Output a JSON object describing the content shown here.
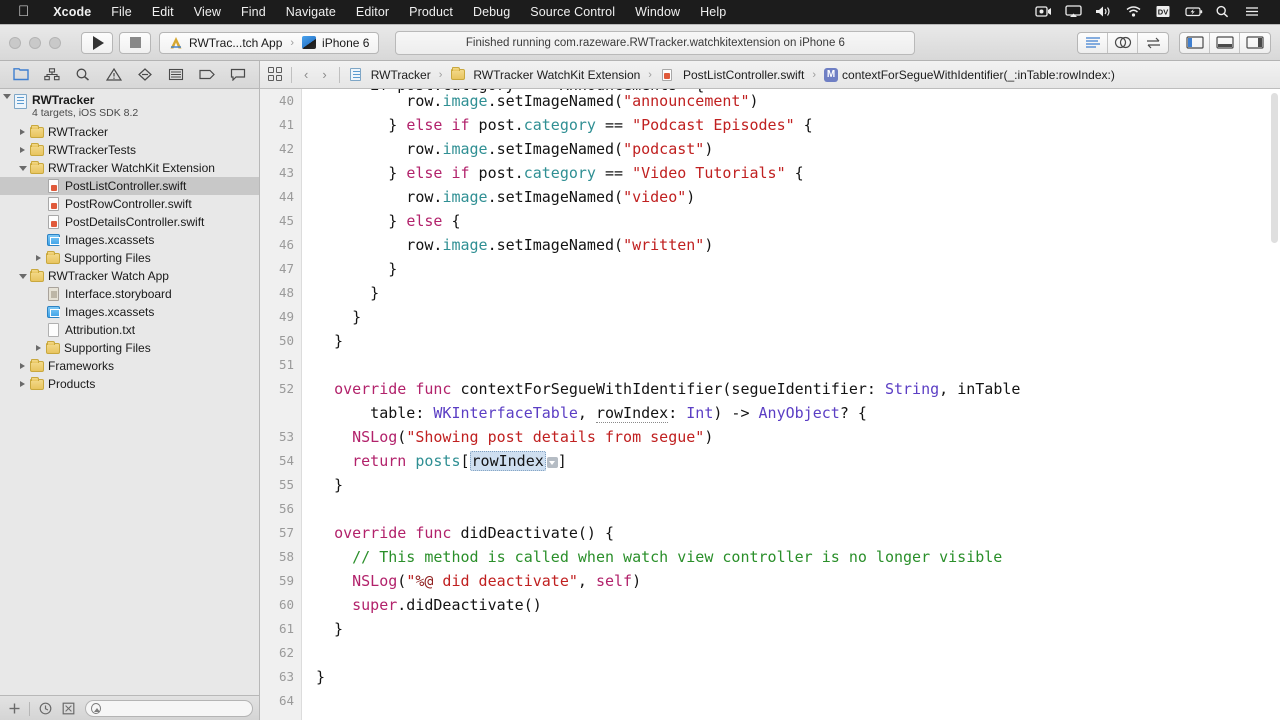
{
  "menubar": {
    "apple_icon": "apple-logo",
    "items": [
      "Xcode",
      "File",
      "Edit",
      "View",
      "Find",
      "Navigate",
      "Editor",
      "Product",
      "Debug",
      "Source Control",
      "Window",
      "Help"
    ],
    "status_icons": [
      "screen-record-icon",
      "airplay-icon",
      "volume-icon",
      "wifi-icon",
      "dv-icon",
      "battery-charging-icon",
      "spotlight-search-icon",
      "notification-center-icon"
    ],
    "dv_label": "DV"
  },
  "toolbar": {
    "run_button": "run-button",
    "stop_button": "stop-button",
    "scheme": {
      "target": "RWTrac...tch App",
      "separator": "›",
      "destination": "iPhone 6"
    },
    "activity_status": "Finished running com.razeware.RWTracker.watchkitextension on iPhone 6",
    "editor_segments": [
      "standard-editor",
      "assistant-editor",
      "version-editor"
    ],
    "view_segments": [
      "navigator-toggle",
      "debug-area-toggle",
      "utilities-toggle"
    ]
  },
  "navigator": {
    "tabs": [
      "project-navigator",
      "symbol-navigator",
      "find-navigator",
      "issue-navigator",
      "test-navigator",
      "debug-navigator",
      "breakpoint-navigator",
      "report-navigator"
    ],
    "active_tab": "project-navigator",
    "tree": [
      {
        "label": "RWTracker",
        "sub": "4 targets, iOS SDK 8.2",
        "icon": "project-icon",
        "indent": 0,
        "twisty": "open",
        "kind": "root"
      },
      {
        "label": "RWTracker",
        "icon": "folder-icon",
        "indent": 1,
        "twisty": "closed",
        "kind": "group"
      },
      {
        "label": "RWTrackerTests",
        "icon": "folder-icon",
        "indent": 1,
        "twisty": "closed",
        "kind": "group"
      },
      {
        "label": "RWTracker WatchKit Extension",
        "icon": "folder-icon",
        "indent": 1,
        "twisty": "open",
        "kind": "group"
      },
      {
        "label": "PostListController.swift",
        "icon": "swift-file-icon",
        "indent": 2,
        "twisty": "none",
        "kind": "file",
        "selected": true
      },
      {
        "label": "PostRowController.swift",
        "icon": "swift-file-icon",
        "indent": 2,
        "twisty": "none",
        "kind": "file"
      },
      {
        "label": "PostDetailsController.swift",
        "icon": "swift-file-icon",
        "indent": 2,
        "twisty": "none",
        "kind": "file"
      },
      {
        "label": "Images.xcassets",
        "icon": "xcassets-icon",
        "indent": 2,
        "twisty": "none",
        "kind": "file"
      },
      {
        "label": "Supporting Files",
        "icon": "folder-icon",
        "indent": 2,
        "twisty": "closed",
        "kind": "group"
      },
      {
        "label": "RWTracker Watch App",
        "icon": "folder-icon",
        "indent": 1,
        "twisty": "open",
        "kind": "group"
      },
      {
        "label": "Interface.storyboard",
        "icon": "storyboard-icon",
        "indent": 2,
        "twisty": "none",
        "kind": "file"
      },
      {
        "label": "Images.xcassets",
        "icon": "xcassets-icon",
        "indent": 2,
        "twisty": "none",
        "kind": "file"
      },
      {
        "label": "Attribution.txt",
        "icon": "text-file-icon",
        "indent": 2,
        "twisty": "none",
        "kind": "file"
      },
      {
        "label": "Supporting Files",
        "icon": "folder-icon",
        "indent": 2,
        "twisty": "closed",
        "kind": "group"
      },
      {
        "label": "Frameworks",
        "icon": "folder-icon",
        "indent": 1,
        "twisty": "closed",
        "kind": "group"
      },
      {
        "label": "Products",
        "icon": "folder-icon",
        "indent": 1,
        "twisty": "closed",
        "kind": "group"
      }
    ],
    "footer": {
      "add_button": "add-button",
      "recent_filter": "recent-files-filter-icon",
      "source_control_filter": "source-control-filter-icon",
      "filter_placeholder": ""
    }
  },
  "jumpbar": {
    "related_items": "related-items-icon",
    "back": "‹",
    "forward": "›",
    "crumbs": [
      {
        "label": "RWTracker",
        "icon": "project-icon"
      },
      {
        "label": "RWTracker WatchKit Extension",
        "icon": "folder-icon"
      },
      {
        "label": "PostListController.swift",
        "icon": "swift-file-icon"
      },
      {
        "label": "contextForSegueWithIdentifier(_:inTable:rowIndex:)",
        "icon": "method-icon",
        "badge": "M"
      }
    ],
    "separator": "›"
  },
  "editor": {
    "first_line_number": 40,
    "last_line_number": 64,
    "clipped_top_line": "      if post.category == \"Announcements\" {",
    "lines": [
      {
        "n": 40,
        "segments": [
          {
            "t": "          row.",
            "c": "plain"
          },
          {
            "t": "image",
            "c": "prop"
          },
          {
            "t": ".",
            "c": "plain"
          },
          {
            "t": "setImageNamed",
            "c": "fn"
          },
          {
            "t": "(",
            "c": "plain"
          },
          {
            "t": "\"announcement\"",
            "c": "str"
          },
          {
            "t": ")",
            "c": "plain"
          }
        ]
      },
      {
        "n": 41,
        "segments": [
          {
            "t": "        } ",
            "c": "plain"
          },
          {
            "t": "else if",
            "c": "kw"
          },
          {
            "t": " post.",
            "c": "plain"
          },
          {
            "t": "category",
            "c": "prop"
          },
          {
            "t": " == ",
            "c": "plain"
          },
          {
            "t": "\"Podcast Episodes\"",
            "c": "str"
          },
          {
            "t": " {",
            "c": "plain"
          }
        ]
      },
      {
        "n": 42,
        "segments": [
          {
            "t": "          row.",
            "c": "plain"
          },
          {
            "t": "image",
            "c": "prop"
          },
          {
            "t": ".",
            "c": "plain"
          },
          {
            "t": "setImageNamed",
            "c": "fn"
          },
          {
            "t": "(",
            "c": "plain"
          },
          {
            "t": "\"podcast\"",
            "c": "str"
          },
          {
            "t": ")",
            "c": "plain"
          }
        ]
      },
      {
        "n": 43,
        "segments": [
          {
            "t": "        } ",
            "c": "plain"
          },
          {
            "t": "else if",
            "c": "kw"
          },
          {
            "t": " post.",
            "c": "plain"
          },
          {
            "t": "category",
            "c": "prop"
          },
          {
            "t": " == ",
            "c": "plain"
          },
          {
            "t": "\"Video Tutorials\"",
            "c": "str"
          },
          {
            "t": " {",
            "c": "plain"
          }
        ]
      },
      {
        "n": 44,
        "segments": [
          {
            "t": "          row.",
            "c": "plain"
          },
          {
            "t": "image",
            "c": "prop"
          },
          {
            "t": ".",
            "c": "plain"
          },
          {
            "t": "setImageNamed",
            "c": "fn"
          },
          {
            "t": "(",
            "c": "plain"
          },
          {
            "t": "\"video\"",
            "c": "str"
          },
          {
            "t": ")",
            "c": "plain"
          }
        ]
      },
      {
        "n": 45,
        "segments": [
          {
            "t": "        } ",
            "c": "plain"
          },
          {
            "t": "else",
            "c": "kw"
          },
          {
            "t": " {",
            "c": "plain"
          }
        ]
      },
      {
        "n": 46,
        "segments": [
          {
            "t": "          row.",
            "c": "plain"
          },
          {
            "t": "image",
            "c": "prop"
          },
          {
            "t": ".",
            "c": "plain"
          },
          {
            "t": "setImageNamed",
            "c": "fn"
          },
          {
            "t": "(",
            "c": "plain"
          },
          {
            "t": "\"written\"",
            "c": "str"
          },
          {
            "t": ")",
            "c": "plain"
          }
        ]
      },
      {
        "n": 47,
        "segments": [
          {
            "t": "        }",
            "c": "plain"
          }
        ]
      },
      {
        "n": 48,
        "segments": [
          {
            "t": "      }",
            "c": "plain"
          }
        ]
      },
      {
        "n": 49,
        "segments": [
          {
            "t": "    }",
            "c": "plain"
          }
        ]
      },
      {
        "n": 50,
        "segments": [
          {
            "t": "  }",
            "c": "plain"
          }
        ]
      },
      {
        "n": 51,
        "segments": []
      },
      {
        "n": 52,
        "segments": [
          {
            "t": "  ",
            "c": "plain"
          },
          {
            "t": "override func",
            "c": "kw"
          },
          {
            "t": " contextForSegueWithIdentifier(segueIdentifier: ",
            "c": "plain"
          },
          {
            "t": "String",
            "c": "type"
          },
          {
            "t": ", inTable",
            "c": "plain"
          }
        ]
      },
      {
        "n": null,
        "segments": [
          {
            "t": "      table: ",
            "c": "plain"
          },
          {
            "t": "WKInterfaceTable",
            "c": "type"
          },
          {
            "t": ", ",
            "c": "plain"
          },
          {
            "t": "rowIndex",
            "c": "plain",
            "underline": true
          },
          {
            "t": ": ",
            "c": "plain"
          },
          {
            "t": "Int",
            "c": "type"
          },
          {
            "t": ") -> ",
            "c": "plain"
          },
          {
            "t": "AnyObject",
            "c": "type"
          },
          {
            "t": "? {",
            "c": "plain"
          }
        ]
      },
      {
        "n": 53,
        "segments": [
          {
            "t": "    ",
            "c": "plain"
          },
          {
            "t": "NSLog",
            "c": "kw"
          },
          {
            "t": "(",
            "c": "plain"
          },
          {
            "t": "\"Showing post details from segue\"",
            "c": "str"
          },
          {
            "t": ")",
            "c": "plain"
          }
        ]
      },
      {
        "n": 54,
        "segments": [
          {
            "t": "    ",
            "c": "plain"
          },
          {
            "t": "return",
            "c": "kw"
          },
          {
            "t": " posts",
            "c": "prop"
          },
          {
            "t": "[",
            "c": "plain"
          },
          {
            "t": "rowIndex",
            "c": "plain",
            "token": true
          },
          {
            "t": "]",
            "c": "plain"
          }
        ]
      },
      {
        "n": 55,
        "segments": [
          {
            "t": "  }",
            "c": "plain"
          }
        ]
      },
      {
        "n": 56,
        "segments": []
      },
      {
        "n": 57,
        "segments": [
          {
            "t": "  ",
            "c": "plain"
          },
          {
            "t": "override func",
            "c": "kw"
          },
          {
            "t": " didDeactivate() {",
            "c": "plain"
          }
        ]
      },
      {
        "n": 58,
        "segments": [
          {
            "t": "    ",
            "c": "plain"
          },
          {
            "t": "// This method is called when watch view controller is no longer visible",
            "c": "cmt"
          }
        ]
      },
      {
        "n": 59,
        "segments": [
          {
            "t": "    ",
            "c": "plain"
          },
          {
            "t": "NSLog",
            "c": "kw"
          },
          {
            "t": "(",
            "c": "plain"
          },
          {
            "t": "\"",
            "c": "str"
          },
          {
            "t": "%@",
            "c": "fmt"
          },
          {
            "t": " did deactivate\"",
            "c": "str"
          },
          {
            "t": ", ",
            "c": "plain"
          },
          {
            "t": "self",
            "c": "kw"
          },
          {
            "t": ")",
            "c": "plain"
          }
        ]
      },
      {
        "n": 60,
        "segments": [
          {
            "t": "    ",
            "c": "plain"
          },
          {
            "t": "super",
            "c": "kw"
          },
          {
            "t": ".didDeactivate()",
            "c": "plain"
          }
        ]
      },
      {
        "n": 61,
        "segments": [
          {
            "t": "  }",
            "c": "plain"
          }
        ]
      },
      {
        "n": 62,
        "segments": []
      },
      {
        "n": 63,
        "segments": [
          {
            "t": "}",
            "c": "plain"
          }
        ]
      },
      {
        "n": 64,
        "segments": []
      }
    ]
  },
  "colors": {
    "accent": "#3c7fd0",
    "menubar_bg": "#1c1c1c",
    "selection": "#c8c8c8",
    "token_highlight": "#cfdff0"
  }
}
